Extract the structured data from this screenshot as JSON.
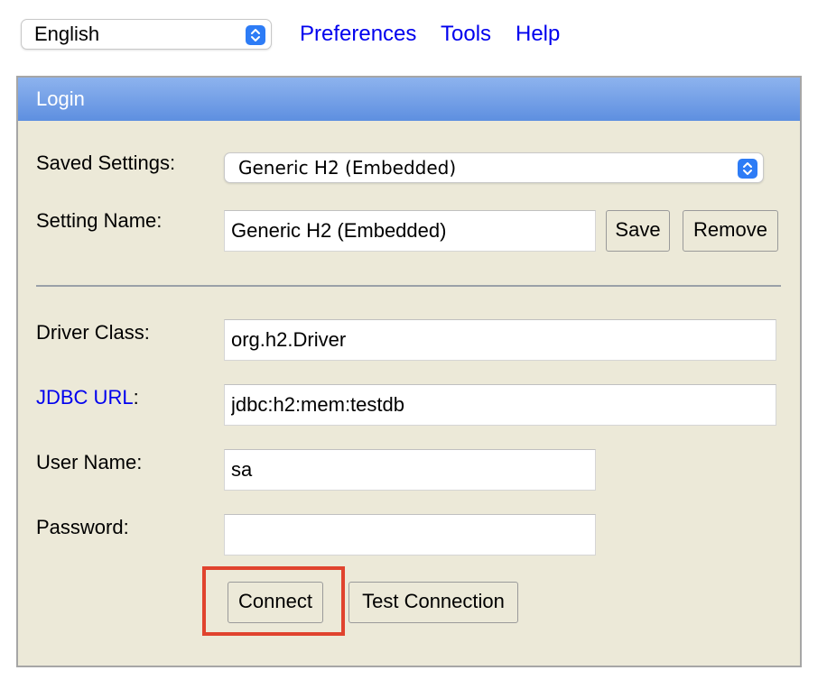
{
  "topbar": {
    "language": "English",
    "links": [
      "Preferences",
      "Tools",
      "Help"
    ]
  },
  "login": {
    "title": "Login",
    "saved_settings_label": "Saved Settings:",
    "saved_settings_value": "Generic H2 (Embedded)",
    "setting_name_label": "Setting Name:",
    "setting_name_value": "Generic H2 (Embedded)",
    "save_label": "Save",
    "remove_label": "Remove",
    "driver_class_label": "Driver Class:",
    "driver_class_value": "org.h2.Driver",
    "jdbc_url_link": "JDBC URL",
    "jdbc_url_colon": ":",
    "jdbc_url_value": "jdbc:h2:mem:testdb",
    "user_name_label": "User Name:",
    "user_name_value": "sa",
    "password_label": "Password:",
    "password_value": "",
    "connect_label": "Connect",
    "test_connection_label": "Test Connection"
  },
  "colors": {
    "link": "#0000ee",
    "header_gradient_top": "#8db3ee",
    "header_gradient_bottom": "#5e8fe0",
    "panel_bg": "#ece9d8",
    "highlight": "#e0432e",
    "select_accent": "#2d7cf6"
  }
}
